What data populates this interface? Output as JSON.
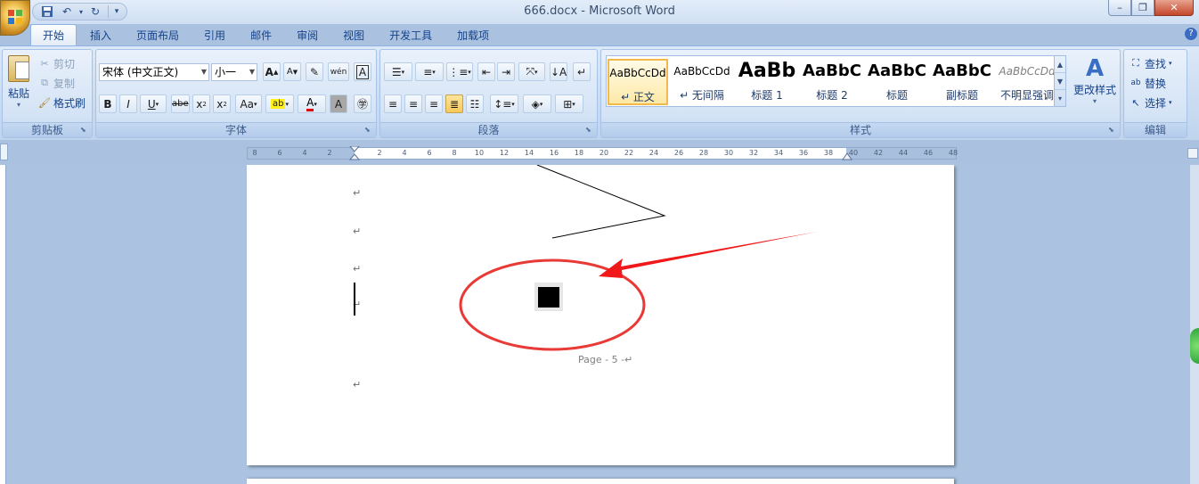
{
  "window": {
    "title": "666.docx - Microsoft Word"
  },
  "tabs": [
    "开始",
    "插入",
    "页面布局",
    "引用",
    "邮件",
    "审阅",
    "视图",
    "开发工具",
    "加载项"
  ],
  "active_tab": "开始",
  "clipboard": {
    "paste": "粘贴",
    "cut": "剪切",
    "copy": "复制",
    "format_painter": "格式刷",
    "label": "剪贴板"
  },
  "font": {
    "name": "宋体 (中文正文)",
    "size": "小一",
    "label": "字体"
  },
  "paragraph": {
    "label": "段落"
  },
  "styles": {
    "items": [
      {
        "sample": "AaBbCcDd",
        "name": "↵ 正文"
      },
      {
        "sample": "AaBbCcDd",
        "name": "↵ 无间隔"
      },
      {
        "sample": "AaBb",
        "name": "标题 1"
      },
      {
        "sample": "AaBbC",
        "name": "标题 2"
      },
      {
        "sample": "AaBbC",
        "name": "标题"
      },
      {
        "sample": "AaBbC",
        "name": "副标题"
      },
      {
        "sample": "AaBbCcDd",
        "name": "不明显强调"
      }
    ],
    "change_styles": "更改样式",
    "label": "样式"
  },
  "editing": {
    "find": "查找",
    "replace": "替换",
    "select": "选择",
    "label": "编辑"
  },
  "ruler": {
    "ticks": [
      "8",
      "6",
      "4",
      "2",
      "2",
      "4",
      "6",
      "8",
      "10",
      "12",
      "14",
      "16",
      "18",
      "20",
      "22",
      "24",
      "26",
      "28",
      "30",
      "32",
      "34",
      "36",
      "38",
      "40",
      "42",
      "44",
      "46",
      "48"
    ]
  },
  "document": {
    "paragraph_mark": "↵",
    "footer": "Page - 5 -↵"
  },
  "colors": {
    "annotation_red": "#e83a36",
    "arrow_red": "#f01818",
    "ribbon_blue": "#c7daf1"
  }
}
